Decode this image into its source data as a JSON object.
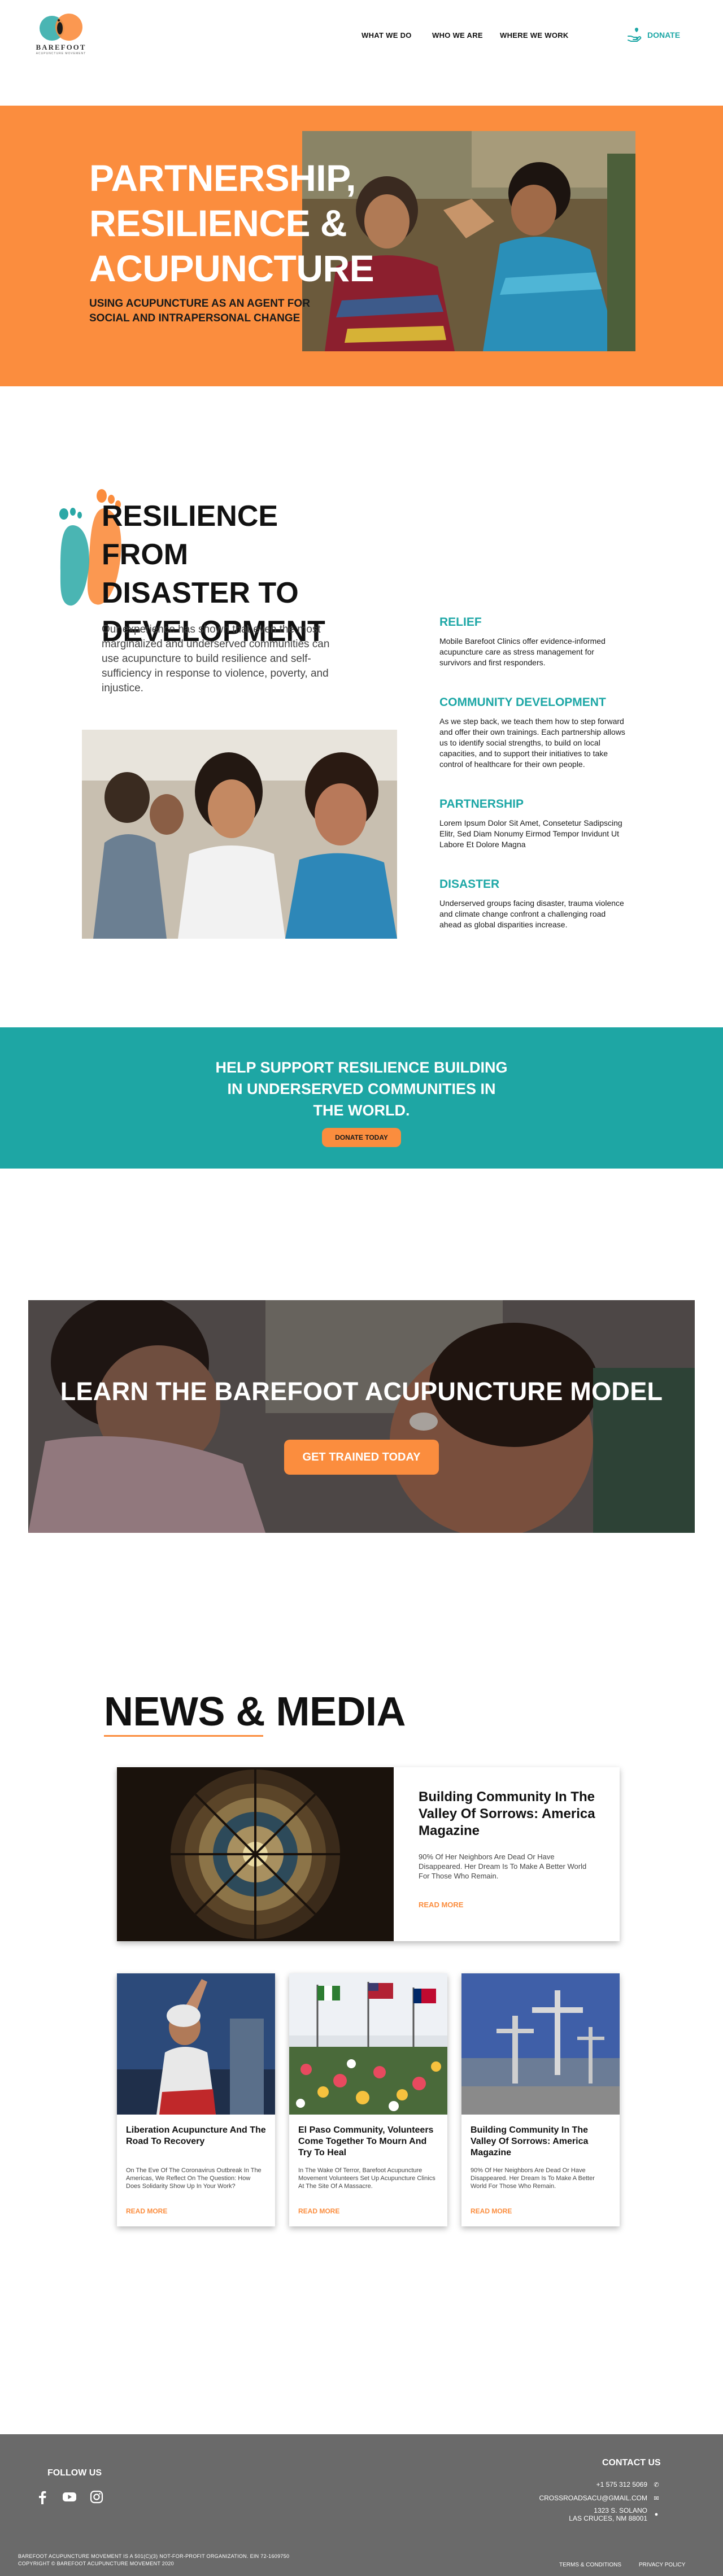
{
  "header": {
    "logo_text": "BAREFOOT",
    "logo_sub": "ACUPUNCTURE MOVEMENT",
    "nav": [
      "WHAT WE DO",
      "WHO WE ARE",
      "WHERE WE WORK"
    ],
    "donate": "DONATE"
  },
  "hero": {
    "title_lines": [
      "PARTNERSHIP,",
      "RESILIENCE &",
      "ACUPUNCTURE"
    ],
    "subtitle": "USING ACUPUNCTURE AS AN AGENT FOR SOCIAL AND INTRAPERSONAL CHANGE"
  },
  "resilience": {
    "title_lines": [
      "RESILIENCE FROM",
      "DISASTER TO",
      "DEVELOPMENT"
    ],
    "body": "Our experience has shown that even the most marginalized and underserved communities can use acupuncture to build resilience and self-sufficiency in response to violence, poverty, and injustice.",
    "items": [
      {
        "heading": "RELIEF",
        "text": "Mobile Barefoot Clinics offer evidence-informed acupuncture care as stress management for survivors and first responders."
      },
      {
        "heading": "COMMUNITY DEVELOPMENT",
        "text": "As we step back, we teach them how to step forward and offer their own trainings. Each partnership allows us to identify social strengths, to build on local capacities, and to support their initiatives to take control of healthcare for their own people."
      },
      {
        "heading": "PARTNERSHIP",
        "text": "Lorem Ipsum Dolor Sit Amet, Consetetur Sadipscing Elitr, Sed Diam Nonumy Eirmod Tempor Invidunt Ut Labore Et Dolore Magna"
      },
      {
        "heading": "DISASTER",
        "text": "Underserved groups facing disaster, trauma violence and climate change confront a challenging road ahead as global disparities increase."
      }
    ]
  },
  "support": {
    "text": "HELP SUPPORT RESILIENCE BUILDING IN UNDERSERVED COMMUNITIES IN THE WORLD.",
    "button": "DONATE TODAY"
  },
  "trained": {
    "title": "LEARN THE BAREFOOT ACUPUNCTURE MODEL",
    "button": "GET TRAINED TODAY"
  },
  "news": {
    "title": "NEWS & MEDIA",
    "feature": {
      "title": "Building Community In The Valley Of Sorrows: America Magazine",
      "text": "90% Of Her Neighbors Are Dead Or Have Disappeared. Her Dream Is To Make A Better World For Those Who Remain.",
      "more": "READ MORE"
    },
    "cards": [
      {
        "title": "Liberation Acupuncture And The Road To Recovery",
        "text": "On The Eve Of The Coronavirus Outbreak In The Americas, We Reflect On The Question: How Does Solidarity Show Up In Your Work?",
        "more": "READ MORE"
      },
      {
        "title": "El Paso Community, Volunteers Come Together To Mourn And Try To Heal",
        "text": "In The Wake Of Terror, Barefoot Acupuncture Movement Volunteers Set Up Acupuncture Clinics At The Site Of A Massacre.",
        "more": "READ MORE"
      },
      {
        "title": "Building Community In The Valley Of Sorrows: America Magazine",
        "text": "90% Of Her Neighbors Are Dead Or Have Disappeared. Her Dream Is To Make A Better World For Those Who Remain.",
        "more": "READ MORE"
      }
    ]
  },
  "footer": {
    "follow": "FOLLOW US",
    "contact_heading": "CONTACT US",
    "phone": "+1 575 312 5069",
    "email": "CROSSROADSACU@GMAIL.COM",
    "address_1": "1323 S. SOLANO",
    "address_2": "LAS CRUCES, NM 88001",
    "legal_1": "BAREFOOT ACUPUNCTURE MOVEMENT IS A 501(C)(3) NOT-FOR-PROFIT ORGANIZATION. EIN 72-1609750",
    "legal_2": "COPYRIGHT © BAREFOOT ACUPUNCTURE MOVEMENT 2020",
    "terms": "TERMS & CONDITIONS",
    "privacy": "PRIVACY POLICY"
  },
  "colors": {
    "orange": "#fb8d3e",
    "teal": "#1ea6a4",
    "footer_gray": "#6a6a6a"
  }
}
